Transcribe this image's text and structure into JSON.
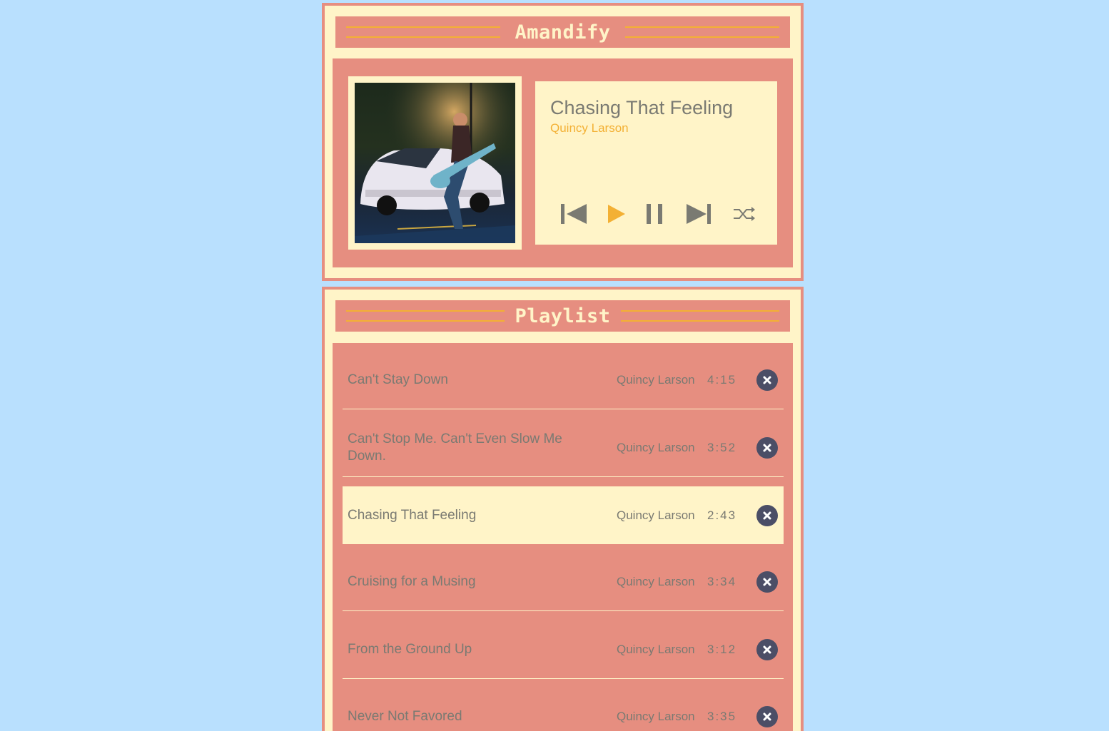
{
  "app": {
    "title": "Amandify",
    "colors": {
      "background": "#b9e0fe",
      "panel": "#fff4c8",
      "accent": "#e68e80",
      "highlight": "#f3b034",
      "text": "#7a7a72",
      "button": "#4b4e66"
    }
  },
  "player": {
    "album_art": "album-cover-guitarist-on-car",
    "now_playing": {
      "title": "Chasing That Feeling",
      "artist": "Quincy Larson"
    },
    "controls": [
      {
        "name": "previous",
        "icon": "skip-previous-icon"
      },
      {
        "name": "play",
        "icon": "play-icon"
      },
      {
        "name": "pause",
        "icon": "pause-icon"
      },
      {
        "name": "next",
        "icon": "skip-next-icon"
      },
      {
        "name": "shuffle",
        "icon": "shuffle-icon"
      }
    ]
  },
  "playlist": {
    "title": "Playlist",
    "tracks": [
      {
        "title": "Can't Stay Down",
        "artist": "Quincy Larson",
        "duration": "4:15",
        "active": false
      },
      {
        "title": "Can't Stop Me. Can't Even Slow Me Down.",
        "artist": "Quincy Larson",
        "duration": "3:52",
        "active": false
      },
      {
        "title": "Chasing That Feeling",
        "artist": "Quincy Larson",
        "duration": "2:43",
        "active": true
      },
      {
        "title": "Cruising for a Musing",
        "artist": "Quincy Larson",
        "duration": "3:34",
        "active": false
      },
      {
        "title": "From the Ground Up",
        "artist": "Quincy Larson",
        "duration": "3:12",
        "active": false
      },
      {
        "title": "Never Not Favored",
        "artist": "Quincy Larson",
        "duration": "3:35",
        "active": false
      }
    ]
  }
}
